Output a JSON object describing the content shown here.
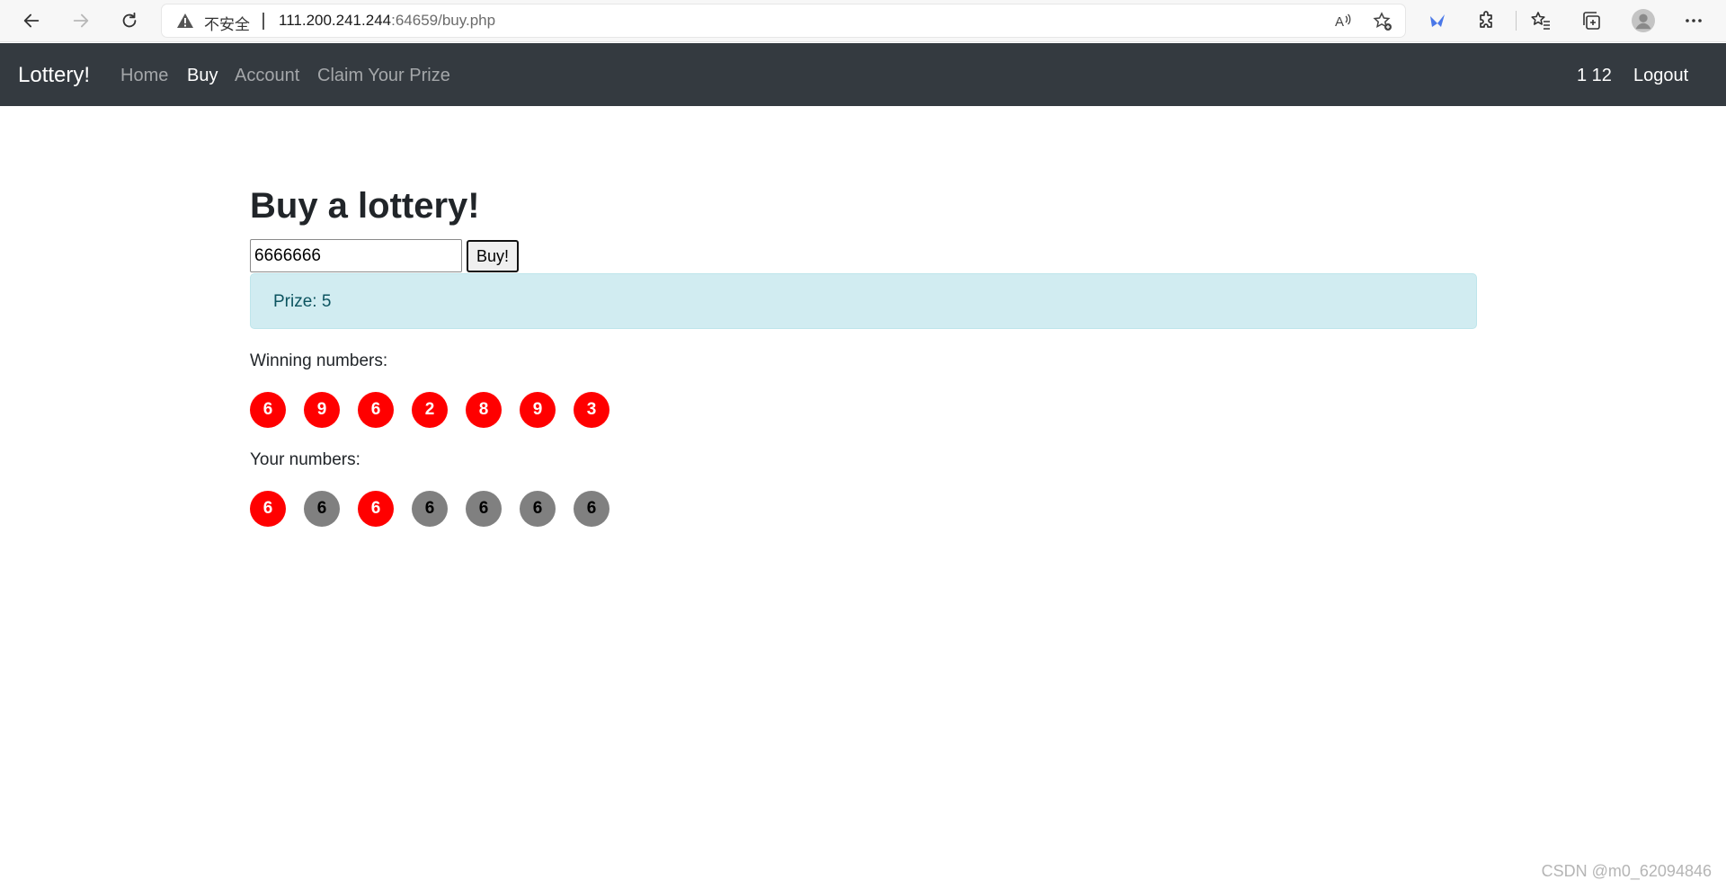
{
  "browser": {
    "security_label": "不安全",
    "url_host": "111.200.241.244",
    "url_rest": ":64659/buy.php",
    "icons": [
      "back-arrow-icon",
      "forward-arrow-icon",
      "reload-icon",
      "warning-icon",
      "read-aloud-icon",
      "favorite-add-icon",
      "extension-bird-icon",
      "puzzle-icon",
      "favorites-icon",
      "collections-icon",
      "profile-icon",
      "more-icon"
    ]
  },
  "navbar": {
    "brand": "Lottery!",
    "links": [
      {
        "label": "Home",
        "active": false
      },
      {
        "label": "Buy",
        "active": true
      },
      {
        "label": "Account",
        "active": false
      },
      {
        "label": "Claim Your Prize",
        "active": false
      }
    ],
    "user_info": "1 12",
    "logout": "Logout"
  },
  "main": {
    "title": "Buy a lottery!",
    "input_value": "6666666",
    "buy_label": "Buy!",
    "prize_text": "Prize: 5",
    "winning_label": "Winning numbers:",
    "your_label": "Your numbers:",
    "winning_numbers": [
      "6",
      "9",
      "6",
      "2",
      "8",
      "9",
      "3"
    ],
    "your_numbers": [
      {
        "value": "6",
        "match": true
      },
      {
        "value": "6",
        "match": false
      },
      {
        "value": "6",
        "match": true
      },
      {
        "value": "6",
        "match": false
      },
      {
        "value": "6",
        "match": false
      },
      {
        "value": "6",
        "match": false
      },
      {
        "value": "6",
        "match": false
      }
    ]
  },
  "colors": {
    "navbar_bg": "#343a40",
    "alert_bg": "#d1ecf1",
    "alert_text": "#0c5460",
    "ball_match": "#ff0000",
    "ball_nomatch": "#808080"
  },
  "watermark": "CSDN @m0_62094846"
}
